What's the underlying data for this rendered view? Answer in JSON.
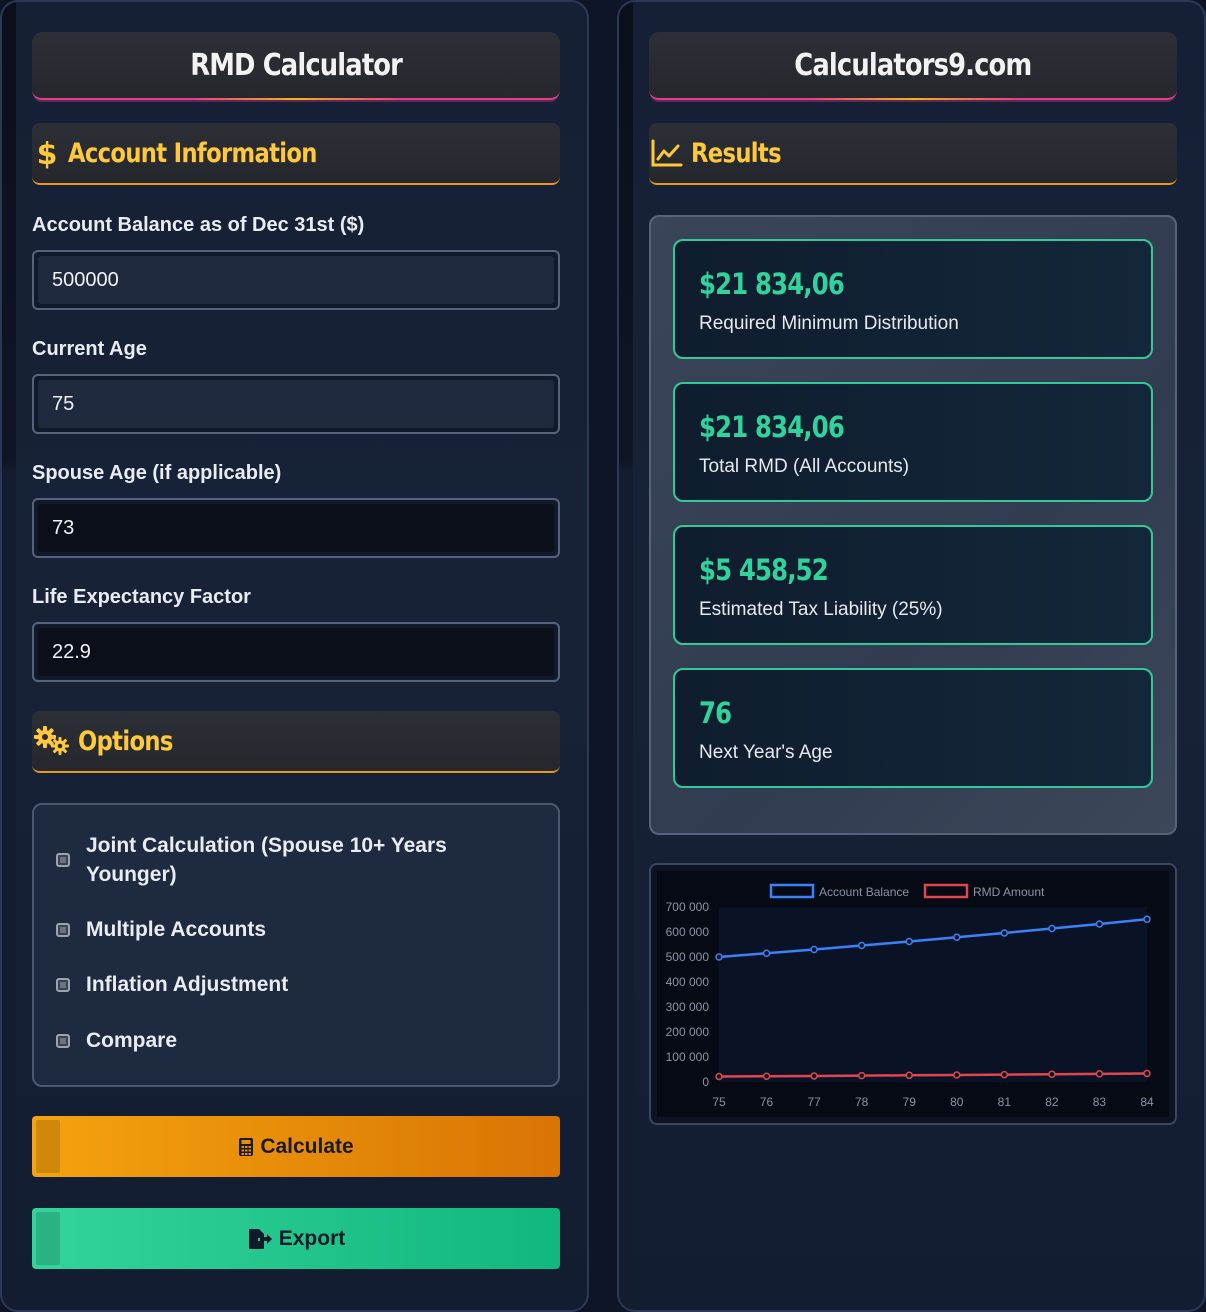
{
  "left": {
    "title": "RMD Calculator",
    "account_section": {
      "label": "Account Information",
      "icon": "dollar-icon"
    },
    "fields": {
      "balance": {
        "label": "Account Balance as of Dec 31st ($)",
        "value": "500000"
      },
      "age": {
        "label": "Current Age",
        "value": "75"
      },
      "spouse_age": {
        "label": "Spouse Age (if applicable)",
        "value": "73"
      },
      "factor": {
        "label": "Life Expectancy Factor",
        "value": "22.9"
      }
    },
    "options_section": {
      "label": "Options",
      "icon": "gears-icon"
    },
    "options": [
      {
        "label": "Joint Calculation (Spouse 10+ Years Younger)",
        "checked": false
      },
      {
        "label": "Multiple Accounts",
        "checked": false
      },
      {
        "label": "Inflation Adjustment",
        "checked": false
      },
      {
        "label": "Compare",
        "checked": false
      }
    ],
    "buttons": {
      "calculate": "Calculate",
      "export": "Export"
    }
  },
  "right": {
    "title": "Calculators9.com",
    "results_section": {
      "label": "Results",
      "icon": "chart-line-icon"
    },
    "results": [
      {
        "value": "$21 834,06",
        "label": "Required Minimum Distribution"
      },
      {
        "value": "$21 834,06",
        "label": "Total RMD (All Accounts)"
      },
      {
        "value": "$5 458,52",
        "label": "Estimated Tax Liability (25%)"
      },
      {
        "value": "76",
        "label": "Next Year's Age"
      }
    ]
  },
  "colors": {
    "accent_gold": "#ffc93a",
    "accent_green": "#2fd49c",
    "accent_pink": "#e63c8a",
    "calc_orange": "#f4a30e",
    "export_green": "#10b77f"
  },
  "chart_data": {
    "type": "line",
    "x": [
      75,
      76,
      77,
      78,
      79,
      80,
      81,
      82,
      83,
      84
    ],
    "series": [
      {
        "name": "Account Balance",
        "color": "#3b82f6",
        "values": [
          500000,
          515000,
          530000,
          546000,
          562000,
          579000,
          596000,
          614000,
          632000,
          651000
        ]
      },
      {
        "name": "RMD Amount",
        "color": "#e0474c",
        "values": [
          21834,
          23000,
          24200,
          25500,
          26800,
          28100,
          29500,
          31000,
          32600,
          34300
        ]
      }
    ],
    "yticks": [
      "700 000",
      "600 000",
      "500 000",
      "400 000",
      "300 000",
      "200 000",
      "100 000",
      "0"
    ],
    "xticks": [
      "75",
      "76",
      "77",
      "78",
      "79",
      "80",
      "81",
      "82",
      "83",
      "84"
    ],
    "ylim": [
      0,
      700000
    ],
    "legend": "top-center",
    "grid": false
  }
}
